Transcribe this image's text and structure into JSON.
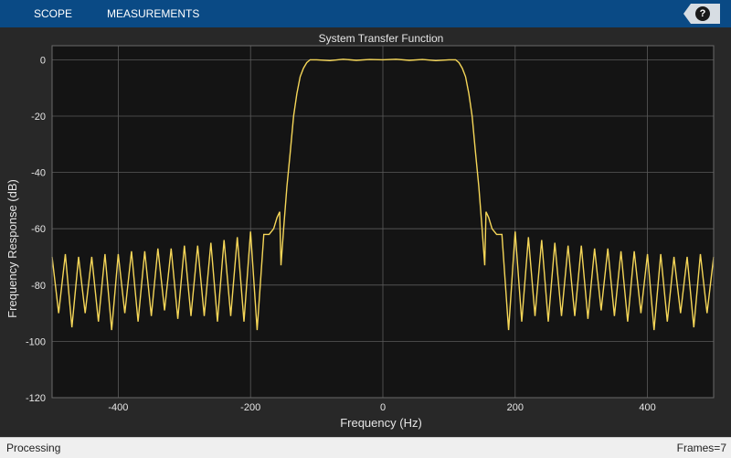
{
  "toolstrip": {
    "tabs": [
      "SCOPE",
      "MEASUREMENTS"
    ],
    "help_label": "?"
  },
  "status": {
    "left": "Processing",
    "right": "Frames=7"
  },
  "colors": {
    "toolstrip": "#0a4a85",
    "plot_bg": "#141414",
    "figure_bg": "#282828",
    "trace": "#f5d658",
    "grid": "#5a5a5a"
  },
  "chart_data": {
    "type": "line",
    "title": "System Transfer Function",
    "xlabel": "Frequency (Hz)",
    "ylabel": "Frequency Response (dB)",
    "xlim": [
      -500,
      500
    ],
    "ylim": [
      -120,
      5
    ],
    "xticks": [
      -400,
      -200,
      0,
      200,
      400
    ],
    "yticks": [
      0,
      -20,
      -40,
      -60,
      -80,
      -100,
      -120
    ],
    "grid": true,
    "series": [
      {
        "x": [
          -500,
          -490,
          -480,
          -470,
          -460,
          -450,
          -440,
          -430,
          -420,
          -410,
          -400,
          -390,
          -380,
          -370,
          -360,
          -350,
          -340,
          -330,
          -320,
          -310,
          -300,
          -290,
          -280,
          -270,
          -260,
          -250,
          -240,
          -230,
          -220,
          -210,
          -200,
          -190,
          -180,
          -172,
          -165,
          -160,
          -156,
          -154,
          -150,
          -145,
          -140,
          -135,
          -130,
          -125,
          -120,
          -115,
          -110,
          -105,
          -100,
          -80,
          -60,
          -40,
          -20,
          0,
          20,
          40,
          60,
          80,
          100,
          105,
          110,
          115,
          120,
          125,
          130,
          135,
          140,
          145,
          150,
          154,
          156,
          160,
          165,
          172,
          180,
          190,
          200,
          210,
          220,
          230,
          240,
          250,
          260,
          270,
          280,
          290,
          300,
          310,
          320,
          330,
          340,
          350,
          360,
          370,
          380,
          390,
          400,
          410,
          420,
          430,
          440,
          450,
          460,
          470,
          480,
          490,
          500
        ],
        "y": [
          -70,
          -90,
          -69,
          -95,
          -70,
          -90,
          -70,
          -93,
          -69,
          -96,
          -69,
          -90,
          -68,
          -93,
          -68,
          -91,
          -67,
          -89,
          -67,
          -92,
          -66,
          -91,
          -66,
          -91,
          -65,
          -93,
          -64,
          -91,
          -63,
          -93,
          -61,
          -96,
          -62,
          -62,
          -60,
          -56,
          -54,
          -73,
          -60,
          -45,
          -33,
          -20,
          -12,
          -6,
          -3,
          -1,
          0,
          0,
          0,
          -0.3,
          0.2,
          -0.2,
          0.1,
          0,
          0.2,
          -0.2,
          0.1,
          -0.3,
          0,
          0,
          0,
          -1,
          -3,
          -6,
          -12,
          -20,
          -33,
          -45,
          -60,
          -73,
          -54,
          -56,
          -60,
          -62,
          -62,
          -96,
          -61,
          -93,
          -63,
          -91,
          -64,
          -93,
          -65,
          -91,
          -66,
          -91,
          -66,
          -92,
          -67,
          -89,
          -67,
          -91,
          -68,
          -93,
          -68,
          -90,
          -69,
          -96,
          -69,
          -93,
          -70,
          -90,
          -70,
          -95,
          -69,
          -90,
          -70
        ]
      }
    ]
  }
}
